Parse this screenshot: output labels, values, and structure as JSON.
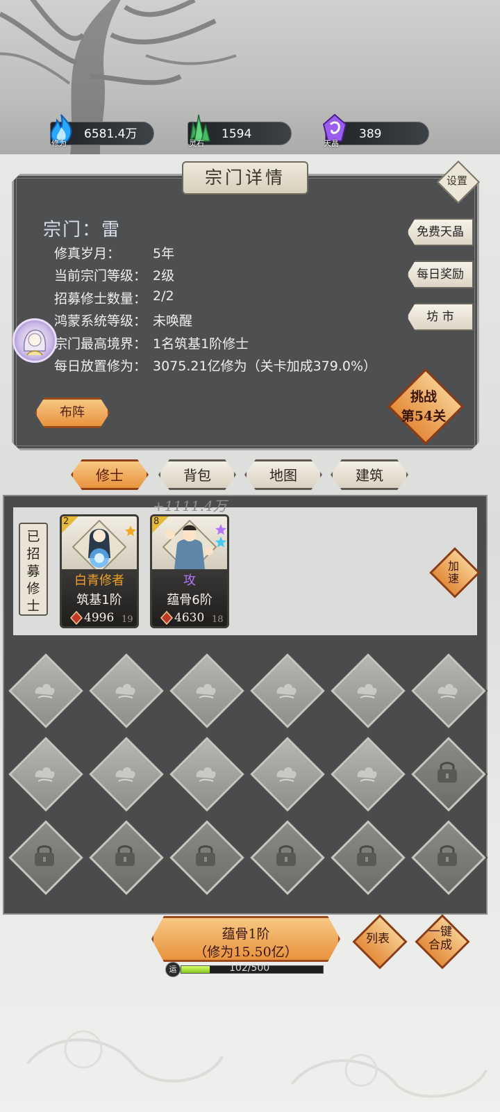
{
  "resources": [
    {
      "icon": "cultivation-flame-icon",
      "label": "修为",
      "value": "6581.4万",
      "color": "#2aa8ff"
    },
    {
      "icon": "spirit-stone-icon",
      "label": "灵石",
      "value": "1594",
      "color": "#4fc46a"
    },
    {
      "icon": "sky-crystal-icon",
      "label": "天晶",
      "value": "389",
      "color": "#9b5cf0"
    }
  ],
  "panel": {
    "title": "宗门详情",
    "settings_label": "设置",
    "sect_name": "宗门：雷",
    "info": [
      {
        "label": "修真岁月：",
        "value": "5年"
      },
      {
        "label": "当前宗门等级：",
        "value": "2级"
      },
      {
        "label": "招募修士数量：",
        "value": "2/2"
      },
      {
        "label": "鸿蒙系统等级：",
        "value": "未唤醒"
      },
      {
        "label": "宗门最高境界：",
        "value": "1名筑基1阶修士"
      },
      {
        "label": "每日放置修为：",
        "value": "3075.21亿修为（关卡加成379.0%）"
      }
    ],
    "side_buttons": [
      "免费天晶",
      "每日奖励",
      "坊 市"
    ],
    "formation_button": "布阵",
    "challenge_line1": "挑战",
    "challenge_line2": "第54关"
  },
  "tabs": [
    {
      "label": "修士",
      "active": true
    },
    {
      "label": "背包",
      "active": false
    },
    {
      "label": "地图",
      "active": false
    },
    {
      "label": "建筑",
      "active": false
    }
  ],
  "recruited": {
    "floating_gain": "+1111.4万",
    "label_chars": [
      "已",
      "招",
      "募",
      "修",
      "士"
    ],
    "speed_label": [
      "加",
      "速"
    ],
    "cards": [
      {
        "corner": "2",
        "name": "白青修者",
        "name_color": "#f0a126",
        "rank": "筑基1阶",
        "power": "4996",
        "level": "19",
        "stars": [
          "#f5a623"
        ]
      },
      {
        "corner": "8",
        "name": "攻",
        "name_color": "#b774ff",
        "rank": "蕴骨6阶",
        "power": "4630",
        "level": "18",
        "stars": [
          "#b774ff",
          "#46c8f0"
        ]
      }
    ]
  },
  "slots": {
    "rows": [
      [
        "open",
        "open",
        "open",
        "open",
        "open",
        "open"
      ],
      [
        "open",
        "open",
        "open",
        "open",
        "open",
        "locked"
      ],
      [
        "locked",
        "locked",
        "locked",
        "locked",
        "locked",
        "locked"
      ]
    ]
  },
  "bottom": {
    "main_line1": "蕴骨1阶",
    "main_line2": "（修为15.50亿）",
    "list_label": "列表",
    "merge_label": [
      "一键",
      "合成"
    ],
    "luck_icon": "运",
    "luck_text": "102/500",
    "luck_fraction": 0.204
  }
}
